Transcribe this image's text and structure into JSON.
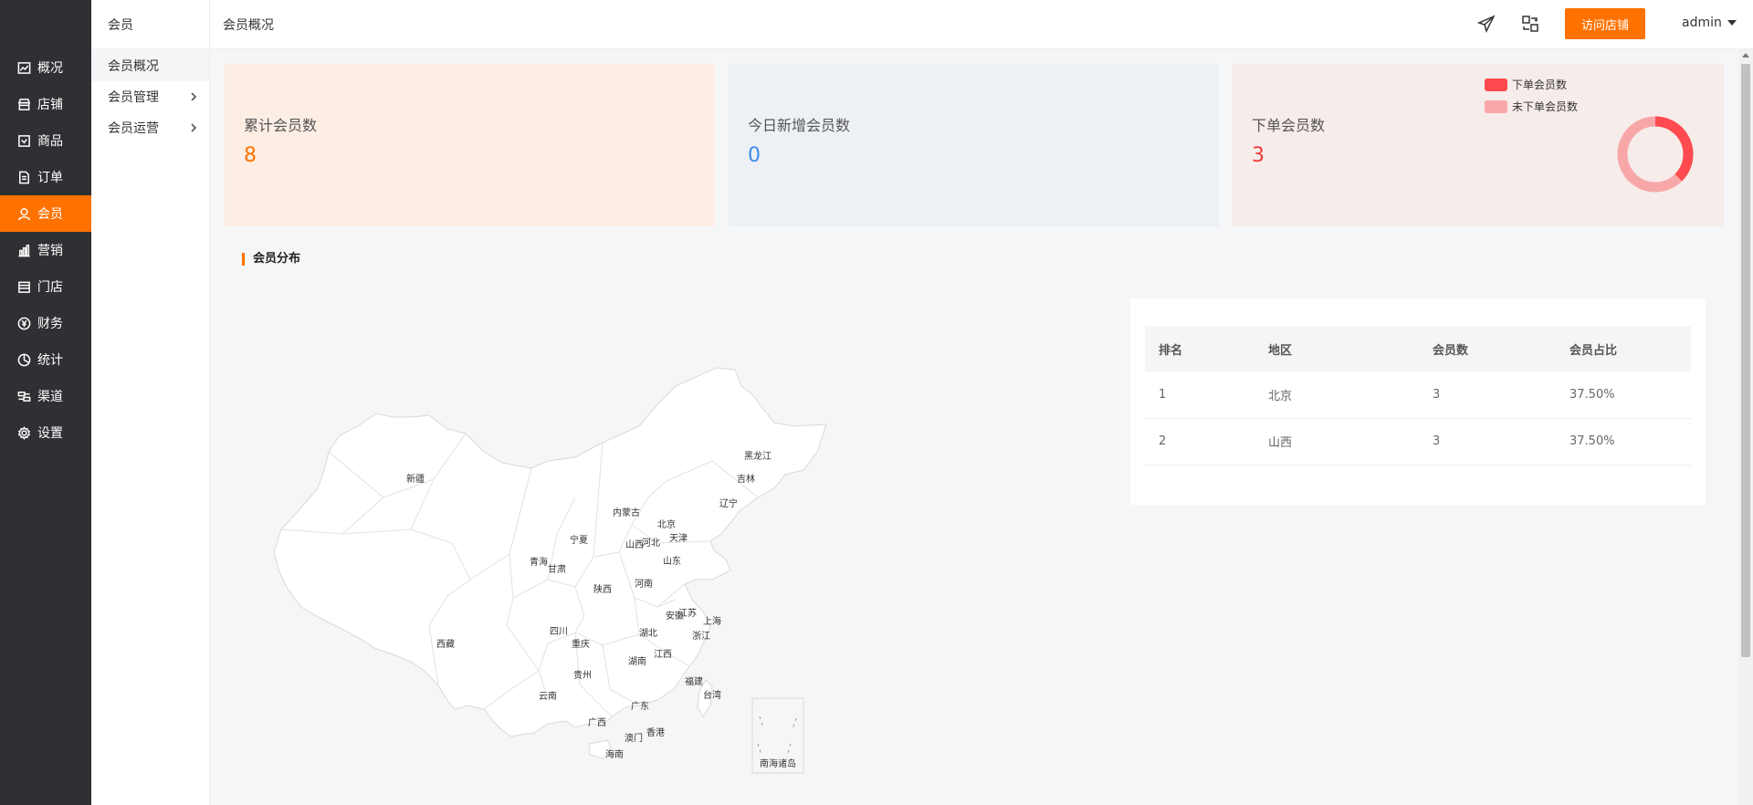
{
  "sidebar": {
    "items": [
      {
        "label": "概况",
        "icon": "chart-line-icon"
      },
      {
        "label": "店铺",
        "icon": "store-icon"
      },
      {
        "label": "商品",
        "icon": "product-icon"
      },
      {
        "label": "订单",
        "icon": "order-icon"
      },
      {
        "label": "会员",
        "icon": "user-icon",
        "active": true
      },
      {
        "label": "营销",
        "icon": "bar-chart-icon"
      },
      {
        "label": "门店",
        "icon": "shop-icon"
      },
      {
        "label": "财务",
        "icon": "yuan-icon"
      },
      {
        "label": "统计",
        "icon": "pie-icon"
      },
      {
        "label": "渠道",
        "icon": "channel-icon"
      },
      {
        "label": "设置",
        "icon": "gear-icon"
      }
    ]
  },
  "submenu": {
    "title": "会员",
    "items": [
      {
        "label": "会员概况"
      },
      {
        "label": "会员管理"
      },
      {
        "label": "会员运营"
      }
    ]
  },
  "header": {
    "breadcrumb": "会员概况",
    "visit_button": "访问店铺",
    "user": "admin"
  },
  "stats": {
    "total": {
      "label": "累计会员数",
      "value": "8"
    },
    "today": {
      "label": "今日新增会员数",
      "value": "0"
    },
    "ordered": {
      "label": "下单会员数",
      "value": "3"
    }
  },
  "donut": {
    "legend_ordered": "下单会员数",
    "legend_not_ordered": "未下单会员数",
    "ordered_fraction": 0.375,
    "colors": {
      "ordered": "#ff4a4f",
      "not_ordered": "#f8a7a9"
    }
  },
  "distribution": {
    "title": "会员分布",
    "map_labels": {
      "xinjiang": "新疆",
      "xizang": "西藏",
      "qinghai": "青海",
      "gansu": "甘肃",
      "neimenggu": "内蒙古",
      "ningxia": "宁夏",
      "shaanxi": "陕西",
      "sichuan": "四川",
      "chongqing": "重庆",
      "yunnan": "云南",
      "guizhou": "贵州",
      "guangxi": "广西",
      "guangdong": "广东",
      "hainan": "海南",
      "macau": "澳门",
      "hongkong": "香港",
      "hunan": "湖南",
      "hubei": "湖北",
      "jiangxi": "江西",
      "fujian": "福建",
      "taiwan": "台湾",
      "zhejiang": "浙江",
      "shanghai": "上海",
      "jiangsu": "江苏",
      "anhui": "安徽",
      "henan": "河南",
      "shandong": "山东",
      "shanxi": "山西",
      "hebei": "河北",
      "beijing": "北京",
      "tianjin": "天津",
      "liaoning": "辽宁",
      "jilin": "吉林",
      "heilongjiang": "黑龙江",
      "nanhai": "南海诸岛"
    },
    "table": {
      "headers": [
        "排名",
        "地区",
        "会员数",
        "会员占比"
      ],
      "rows": [
        [
          "1",
          "北京",
          "3",
          "37.50%"
        ],
        [
          "2",
          "山西",
          "3",
          "37.50%"
        ]
      ]
    }
  }
}
